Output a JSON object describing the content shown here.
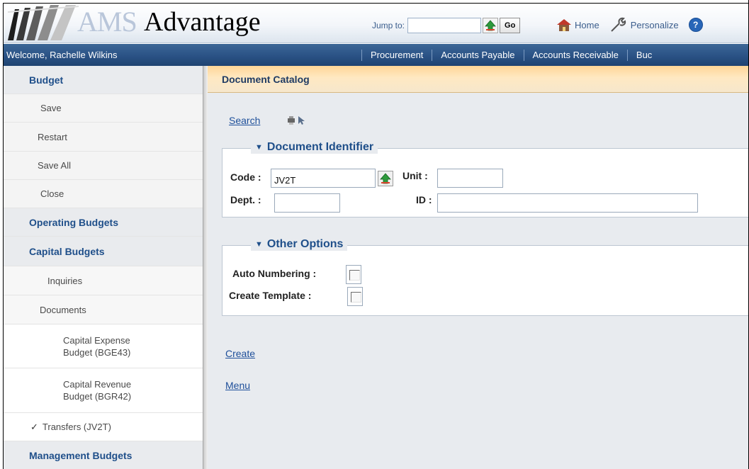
{
  "header": {
    "logo_ams": "AMS",
    "logo_advantage": "Advantage",
    "jump_label": "Jump to:",
    "jump_value": "",
    "go_label": "Go",
    "nav": [
      {
        "label": "Home",
        "icon": "home-icon"
      },
      {
        "label": "Personalize",
        "icon": "wrench-icon"
      }
    ],
    "help_icon_text": "?"
  },
  "navbar": {
    "welcome": "Welcome, Rachelle Wilkins",
    "tabs": [
      "Procurement",
      "Accounts Payable",
      "Accounts Receivable",
      "Buc"
    ]
  },
  "sidebar": {
    "budget": "Budget",
    "save": "Save",
    "restart": "Restart",
    "save_all": "Save All",
    "close": "Close",
    "operating_budgets": "Operating Budgets",
    "capital_budgets": "Capital Budgets",
    "inquiries": "Inquiries",
    "documents": "Documents",
    "capital_expense_1": "Capital Expense",
    "capital_expense_2": "Budget (BGE43)",
    "capital_revenue_1": "Capital Revenue",
    "capital_revenue_2": "Budget (BGR42)",
    "transfers": "Transfers (JV2T)",
    "management_budgets": "Management Budgets"
  },
  "main": {
    "title": "Document Catalog",
    "search_link": "Search",
    "doc_identifier": {
      "legend": "Document Identifier",
      "code_label": "Code :",
      "code_value": "JV2T",
      "unit_label": "Unit :",
      "unit_value": "",
      "dept_label": "Dept. :",
      "dept_value": "",
      "id_label": "ID :",
      "id_value": ""
    },
    "other_options": {
      "legend": "Other Options",
      "auto_numbering_label": "Auto Numbering :",
      "auto_numbering_checked": false,
      "create_template_label": "Create Template :",
      "create_template_checked": false
    },
    "create_link": "Create",
    "menu_link": "Menu"
  },
  "colors": {
    "nav_blue": "#2a5285",
    "sidebar_heading": "#1f4f8a",
    "header_orange": "#ffd697",
    "link_blue": "#1e4f9a"
  }
}
